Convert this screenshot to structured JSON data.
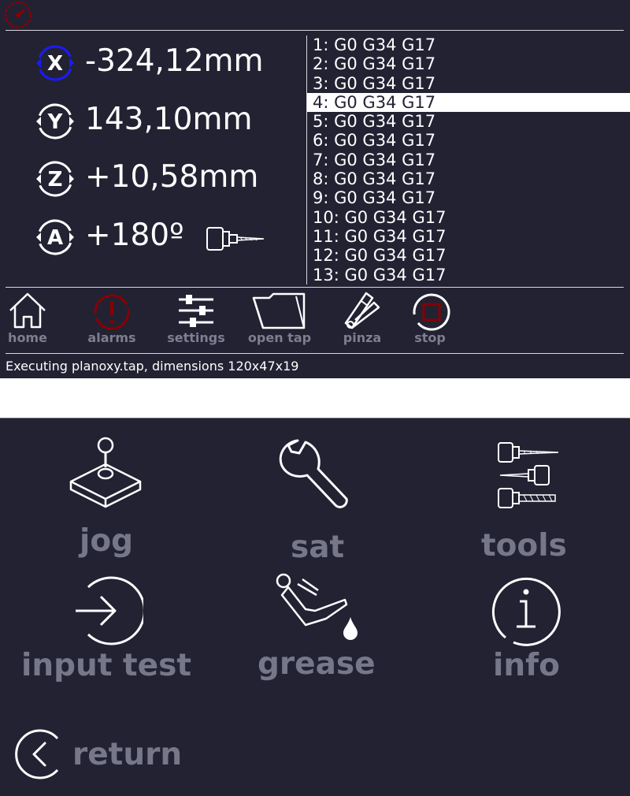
{
  "axes": [
    {
      "axis": "X",
      "value": "-324,12mm",
      "active": true
    },
    {
      "axis": "Y",
      "value": "143,10mm",
      "active": false
    },
    {
      "axis": "Z",
      "value": "+10,58mm",
      "active": false
    },
    {
      "axis": "A",
      "value": "+180º",
      "active": false
    }
  ],
  "gcode_lines": [
    "1: G0 G34 G17",
    "2: G0 G34 G17",
    "3: G0 G34 G17",
    "4: G0 G34 G17",
    "5: G0 G34 G17",
    "6: G0 G34 G17",
    "7: G0 G34 G17",
    "8: G0 G34 G17",
    "9: G0 G34 G17",
    "10: G0 G34 G17",
    "11: G0 G34 G17",
    "12: G0 G34 G17",
    "13: G0 G34 G17"
  ],
  "selected_line": 4,
  "toolbar": {
    "home": "home",
    "alarms": "alarms",
    "settings": "settings",
    "open_tap": "open tap",
    "pinza": "pinza",
    "stop": "stop"
  },
  "status": "Executing planoxy.tap, dimensions 120x47x19",
  "menu": {
    "jog": "jog",
    "sat": "sat",
    "tools": "tools",
    "input_test": "input test",
    "grease": "grease",
    "info": "info",
    "return": "return"
  },
  "colors": {
    "background": "#222233",
    "text": "#ffffff",
    "label_gray": "#77778a",
    "active_axis": "#1a1aff",
    "alarm": "#880000"
  },
  "icons": {
    "speed": "speedometer-icon",
    "home": "home-icon",
    "alarms": "alarm-icon",
    "settings": "sliders-icon",
    "open_tap": "folder-open-icon",
    "pinza": "collet-icon",
    "stop": "stop-icon",
    "jog": "joystick-icon",
    "sat": "wrench-icon",
    "tools": "tools-icon",
    "input_test": "input-arrow-icon",
    "grease": "oil-can-icon",
    "info": "info-icon",
    "return": "back-icon"
  }
}
